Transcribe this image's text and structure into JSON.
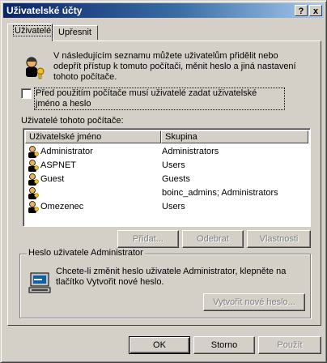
{
  "window": {
    "title": "Uživatelské účty",
    "help_button": "?",
    "close_button": "x"
  },
  "tabs": [
    {
      "label": "Uživatelé",
      "active": true
    },
    {
      "label": "Upřesnit",
      "active": false
    }
  ],
  "intro": {
    "text": "V následujícím seznamu můžete uživatelům přidělit nebo odepřít přístup k tomuto počítači, měnit heslo a jiná nastavení tohoto počítače.",
    "icon": "users-keys-icon"
  },
  "require_login_checkbox": {
    "label": "Před použitím počítače musí uživatelé zadat uživatelské jméno a heslo",
    "checked": false
  },
  "users_list": {
    "label": "Uživatelé tohoto počítače:",
    "columns": [
      "Uživatelské jméno",
      "Skupina"
    ],
    "rows": [
      {
        "name": "Administrator",
        "group": "Administrators"
      },
      {
        "name": "ASPNET",
        "group": "Users"
      },
      {
        "name": "Guest",
        "group": "Guests"
      },
      {
        "name": "",
        "group": "boinc_admins; Administrators"
      },
      {
        "name": "Omezenec",
        "group": "Users"
      }
    ]
  },
  "list_buttons": {
    "add": "Přidat...",
    "remove": "Odebrat",
    "properties": "Vlastnosti"
  },
  "password_group": {
    "title": "Heslo uživatele Administrator",
    "text": "Chcete-li změnit heslo uživatele Administrator, klepněte na tlačítko Vytvořit nové heslo.",
    "button": "Vytvořit nové heslo...",
    "icon": "computer-password-icon"
  },
  "footer_buttons": {
    "ok": "OK",
    "cancel": "Storno",
    "apply": "Použít"
  }
}
